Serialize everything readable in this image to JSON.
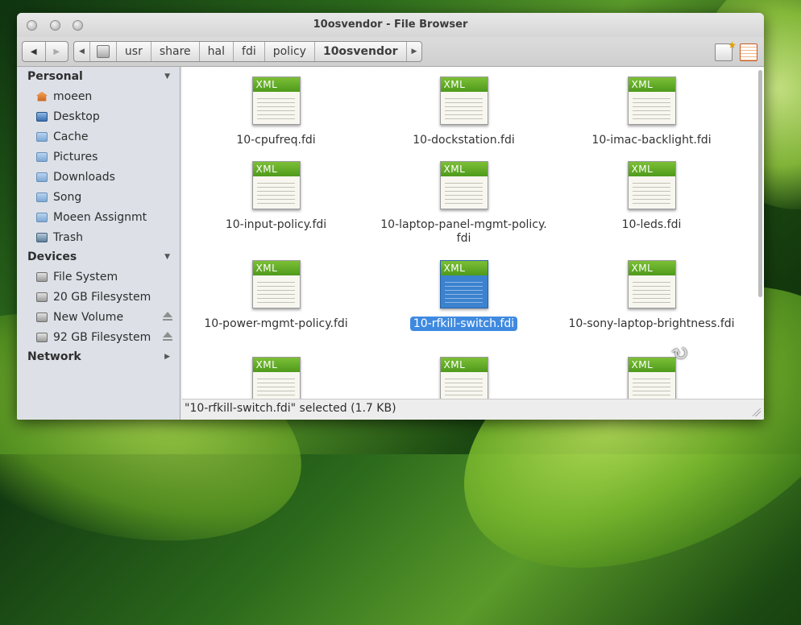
{
  "window": {
    "title": "10osvendor - File Browser"
  },
  "toolbar": {
    "back_icon": "back-arrow-icon",
    "forward_icon": "forward-arrow-icon",
    "breadcrumb": [
      "usr",
      "share",
      "hal",
      "fdi",
      "policy",
      "10osvendor"
    ]
  },
  "sidebar": {
    "personal": {
      "title": "Personal",
      "items": [
        {
          "label": "moeen",
          "icon": "home-icon"
        },
        {
          "label": "Desktop",
          "icon": "desktop-icon"
        },
        {
          "label": "Cache",
          "icon": "folder-icon"
        },
        {
          "label": "Pictures",
          "icon": "folder-icon"
        },
        {
          "label": "Downloads",
          "icon": "folder-icon"
        },
        {
          "label": "Song",
          "icon": "folder-icon"
        },
        {
          "label": "Moeen Assignmt",
          "icon": "folder-icon"
        },
        {
          "label": "Trash",
          "icon": "trash-icon"
        }
      ]
    },
    "devices": {
      "title": "Devices",
      "items": [
        {
          "label": "File System",
          "icon": "drive-icon",
          "eject": false
        },
        {
          "label": "20 GB Filesystem",
          "icon": "drive-icon",
          "eject": false
        },
        {
          "label": "New Volume",
          "icon": "drive-icon",
          "eject": true
        },
        {
          "label": "92 GB Filesystem",
          "icon": "drive-icon",
          "eject": true
        }
      ]
    },
    "network": {
      "title": "Network"
    }
  },
  "files": [
    {
      "name": "10-cpufreq.fdi",
      "badge": "XML"
    },
    {
      "name": "10-dockstation.fdi",
      "badge": "XML"
    },
    {
      "name": "10-imac-backlight.fdi",
      "badge": "XML"
    },
    {
      "name": "10-input-policy.fdi",
      "badge": "XML"
    },
    {
      "name": "10-laptop-panel-mgmt-policy.\nfdi",
      "badge": "XML"
    },
    {
      "name": "10-leds.fdi",
      "badge": "XML"
    },
    {
      "name": "10-power-mgmt-policy.fdi",
      "badge": "XML"
    },
    {
      "name": "10-rfkill-switch.fdi",
      "badge": "XML",
      "selected": true
    },
    {
      "name": "10-sony-laptop-brightness.fdi",
      "badge": "XML"
    },
    {
      "name": "",
      "badge": "XML"
    },
    {
      "name": "",
      "badge": "XML"
    },
    {
      "name": "",
      "badge": "XML"
    }
  ],
  "statusbar": {
    "text": "\"10-rfkill-switch.fdi\" selected (1.7 KB)"
  },
  "colors": {
    "selection": "#3f8ae0",
    "sidebar_bg": "#dde1e7",
    "xml_badge": "#5fa626"
  }
}
